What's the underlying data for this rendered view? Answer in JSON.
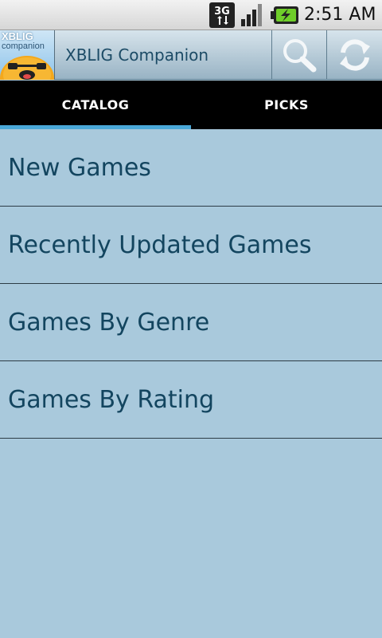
{
  "status_bar": {
    "network_type": "3G",
    "time": "2:51 AM",
    "icons": [
      "3g-data-icon",
      "signal-strength-icon",
      "battery-charging-icon"
    ]
  },
  "action_bar": {
    "logo_text_line1": "XBLIG",
    "logo_text_line2": "companion",
    "title": "XBLIG Companion",
    "actions": [
      {
        "name": "search",
        "icon": "search-icon"
      },
      {
        "name": "refresh",
        "icon": "refresh-icon"
      }
    ]
  },
  "tabs": [
    {
      "label": "CATALOG",
      "selected": true
    },
    {
      "label": "PICKS",
      "selected": false
    }
  ],
  "catalog": {
    "items": [
      {
        "label": "New Games"
      },
      {
        "label": "Recently Updated Games"
      },
      {
        "label": "Games By Genre"
      },
      {
        "label": "Games By Rating"
      }
    ]
  },
  "colors": {
    "background": "#a9c9dc",
    "list_text": "#13455f",
    "tab_indicator": "#4aa8d8",
    "title_text": "#1c4b66"
  }
}
